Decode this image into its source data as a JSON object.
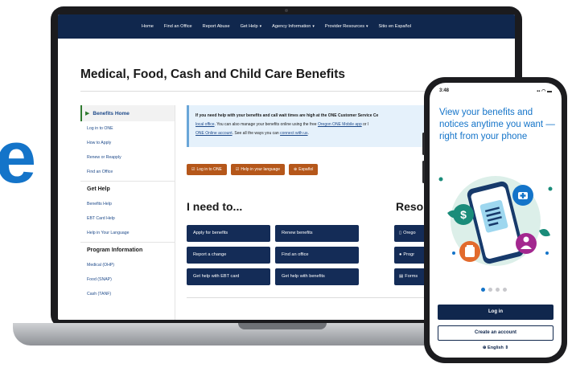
{
  "brand": {
    "letter": "e",
    "color": "#1474c9"
  },
  "site": {
    "nav": [
      {
        "label": "Home",
        "caret": false
      },
      {
        "label": "Find an Office",
        "caret": false
      },
      {
        "label": "Report Abuse",
        "caret": false
      },
      {
        "label": "Get Help",
        "caret": true
      },
      {
        "label": "Agency Information",
        "caret": true
      },
      {
        "label": "Provider Resources",
        "caret": true
      },
      {
        "label": "Sitio en Español",
        "caret": false
      }
    ],
    "nav_color": "#10274d",
    "title": "Medical, Food, Cash and Child Care Benefits",
    "sidebar": {
      "home": "Benefits Home",
      "home_links": [
        "Log in to ONE",
        "How to Apply",
        "Renew or Reapply",
        "Find an Office"
      ],
      "sections": [
        {
          "heading": "Get Help",
          "links": [
            "Benefits Help",
            "EBT Card Help",
            "Help in Your Language"
          ]
        },
        {
          "heading": "Program Information",
          "links": [
            "Medical (OHP)",
            "Food (SNAP)",
            "Cash (TANF)"
          ]
        }
      ]
    },
    "alert": {
      "line1_bold": "If you need help with your benefits and call wait times are high at the ONE Customer Service Ce",
      "line2_link": "local office",
      "line2_text": ". You can also manage your benefits online using the free",
      "line2_link2": "Oregon ONE Mobile app",
      "line2_tail": " or l",
      "line3_link": "ONE Online account",
      "line3_text": ". See all the ways you can",
      "line3_link2": "connect with us",
      "line3_tail": "."
    },
    "pills": [
      {
        "icon": "☑",
        "label": "Log in to ONE"
      },
      {
        "icon": "☑",
        "label": "Help in your language"
      },
      {
        "icon": "⊕",
        "label": "Español"
      }
    ],
    "accent_orange": "#b5571a",
    "ineed_heading": "I need to...",
    "resources_heading": "Reso",
    "actions": [
      "Apply for benefits",
      "Renew benefits",
      "Report a change",
      "Find an office",
      "Get help with EBT card",
      "Get help with benefits"
    ],
    "resources": [
      {
        "icon": "▯",
        "label": "Orego"
      },
      {
        "icon": "●",
        "label": "Progr"
      },
      {
        "icon": "▤",
        "label": "Forms"
      }
    ]
  },
  "phone": {
    "time": "3:48",
    "status_icons": "▪▪ ◠ ▬",
    "headline": "View your benefits and notices anytime you want — right from your phone",
    "headline_color": "#1474c9",
    "illustration_icons": [
      "dollar-icon",
      "document-icon",
      "medical-icon",
      "food-icon",
      "child-icon"
    ],
    "carousel": {
      "total": 4,
      "active": 1
    },
    "login_label": "Log in",
    "create_label": "Create an account",
    "language_label": "⊕ English ⇕"
  }
}
